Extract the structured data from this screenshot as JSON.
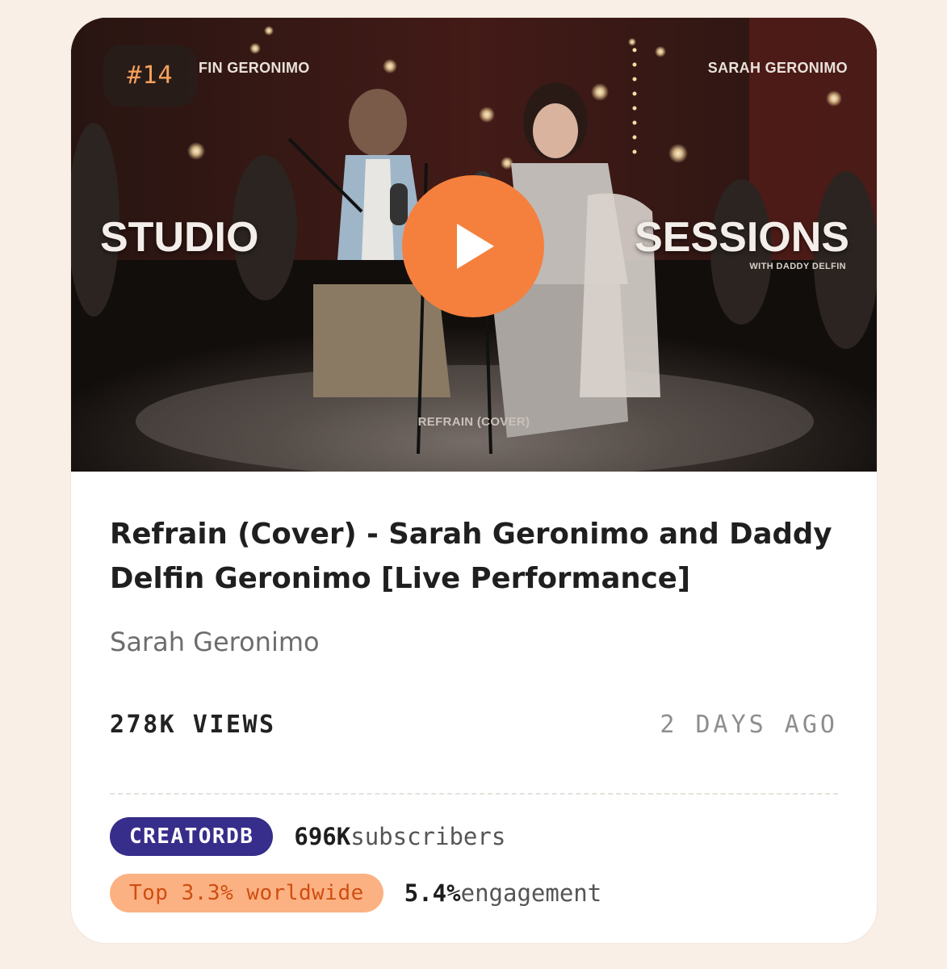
{
  "card": {
    "rank": "#14",
    "thumbnail": {
      "overlay_left_name": "FIN GERONIMO",
      "overlay_right_name": "SARAH GERONIMO",
      "headline_left": "STUDIO",
      "headline_right": "SESSIONS",
      "headline_sub": "WITH DADDY DELFIN",
      "song_caption": "REFRAIN (COVER)"
    },
    "play_icon": "play-icon",
    "title": "Refrain (Cover) - Sarah Geronimo and Daddy Delfin Geronimo [Live Performance]",
    "channel": "Sarah Geronimo",
    "views": "278K VIEWS",
    "age": "2 DAYS AGO",
    "stats": {
      "brand_label": "CREATORDB",
      "subscribers_value": "696K",
      "subscribers_label": "subscribers",
      "rank_label": "Top 3.3% worldwide",
      "engagement_value": "5.4%",
      "engagement_label": "engagement"
    }
  },
  "colors": {
    "background": "#f9efe6",
    "accent": "#f5803e",
    "brand_pill": "#372d8a",
    "rank_pill": "#fcb183"
  }
}
